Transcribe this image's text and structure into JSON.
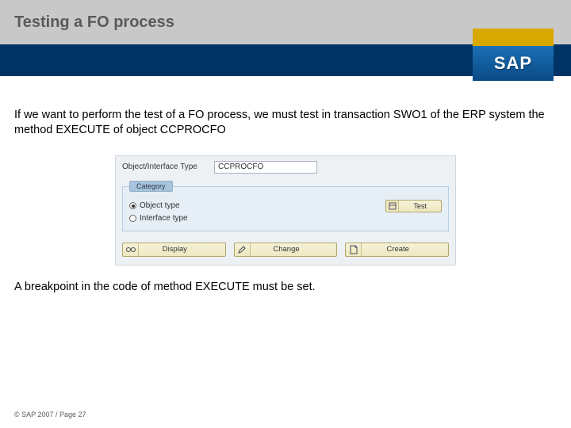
{
  "header": {
    "title": "Testing a FO process"
  },
  "logo": {
    "text": "SAP"
  },
  "body": {
    "para1": "If we want to perform the test of a FO process, we must test in transaction SWO1 of the ERP system the method EXECUTE of object CCPROCFO",
    "para2": "A breakpoint in the code of method EXECUTE must be set."
  },
  "sap": {
    "objLabel": "Object/Interface Type",
    "objValue": "CCPROCFO",
    "categoryTitle": "Category",
    "radio1": "Object type",
    "radio2": "Interface type",
    "testBtn": "Test",
    "displayBtn": "Display",
    "changeBtn": "Change",
    "createBtn": "Create"
  },
  "footer": {
    "text": "© SAP 2007 / Page 27"
  }
}
